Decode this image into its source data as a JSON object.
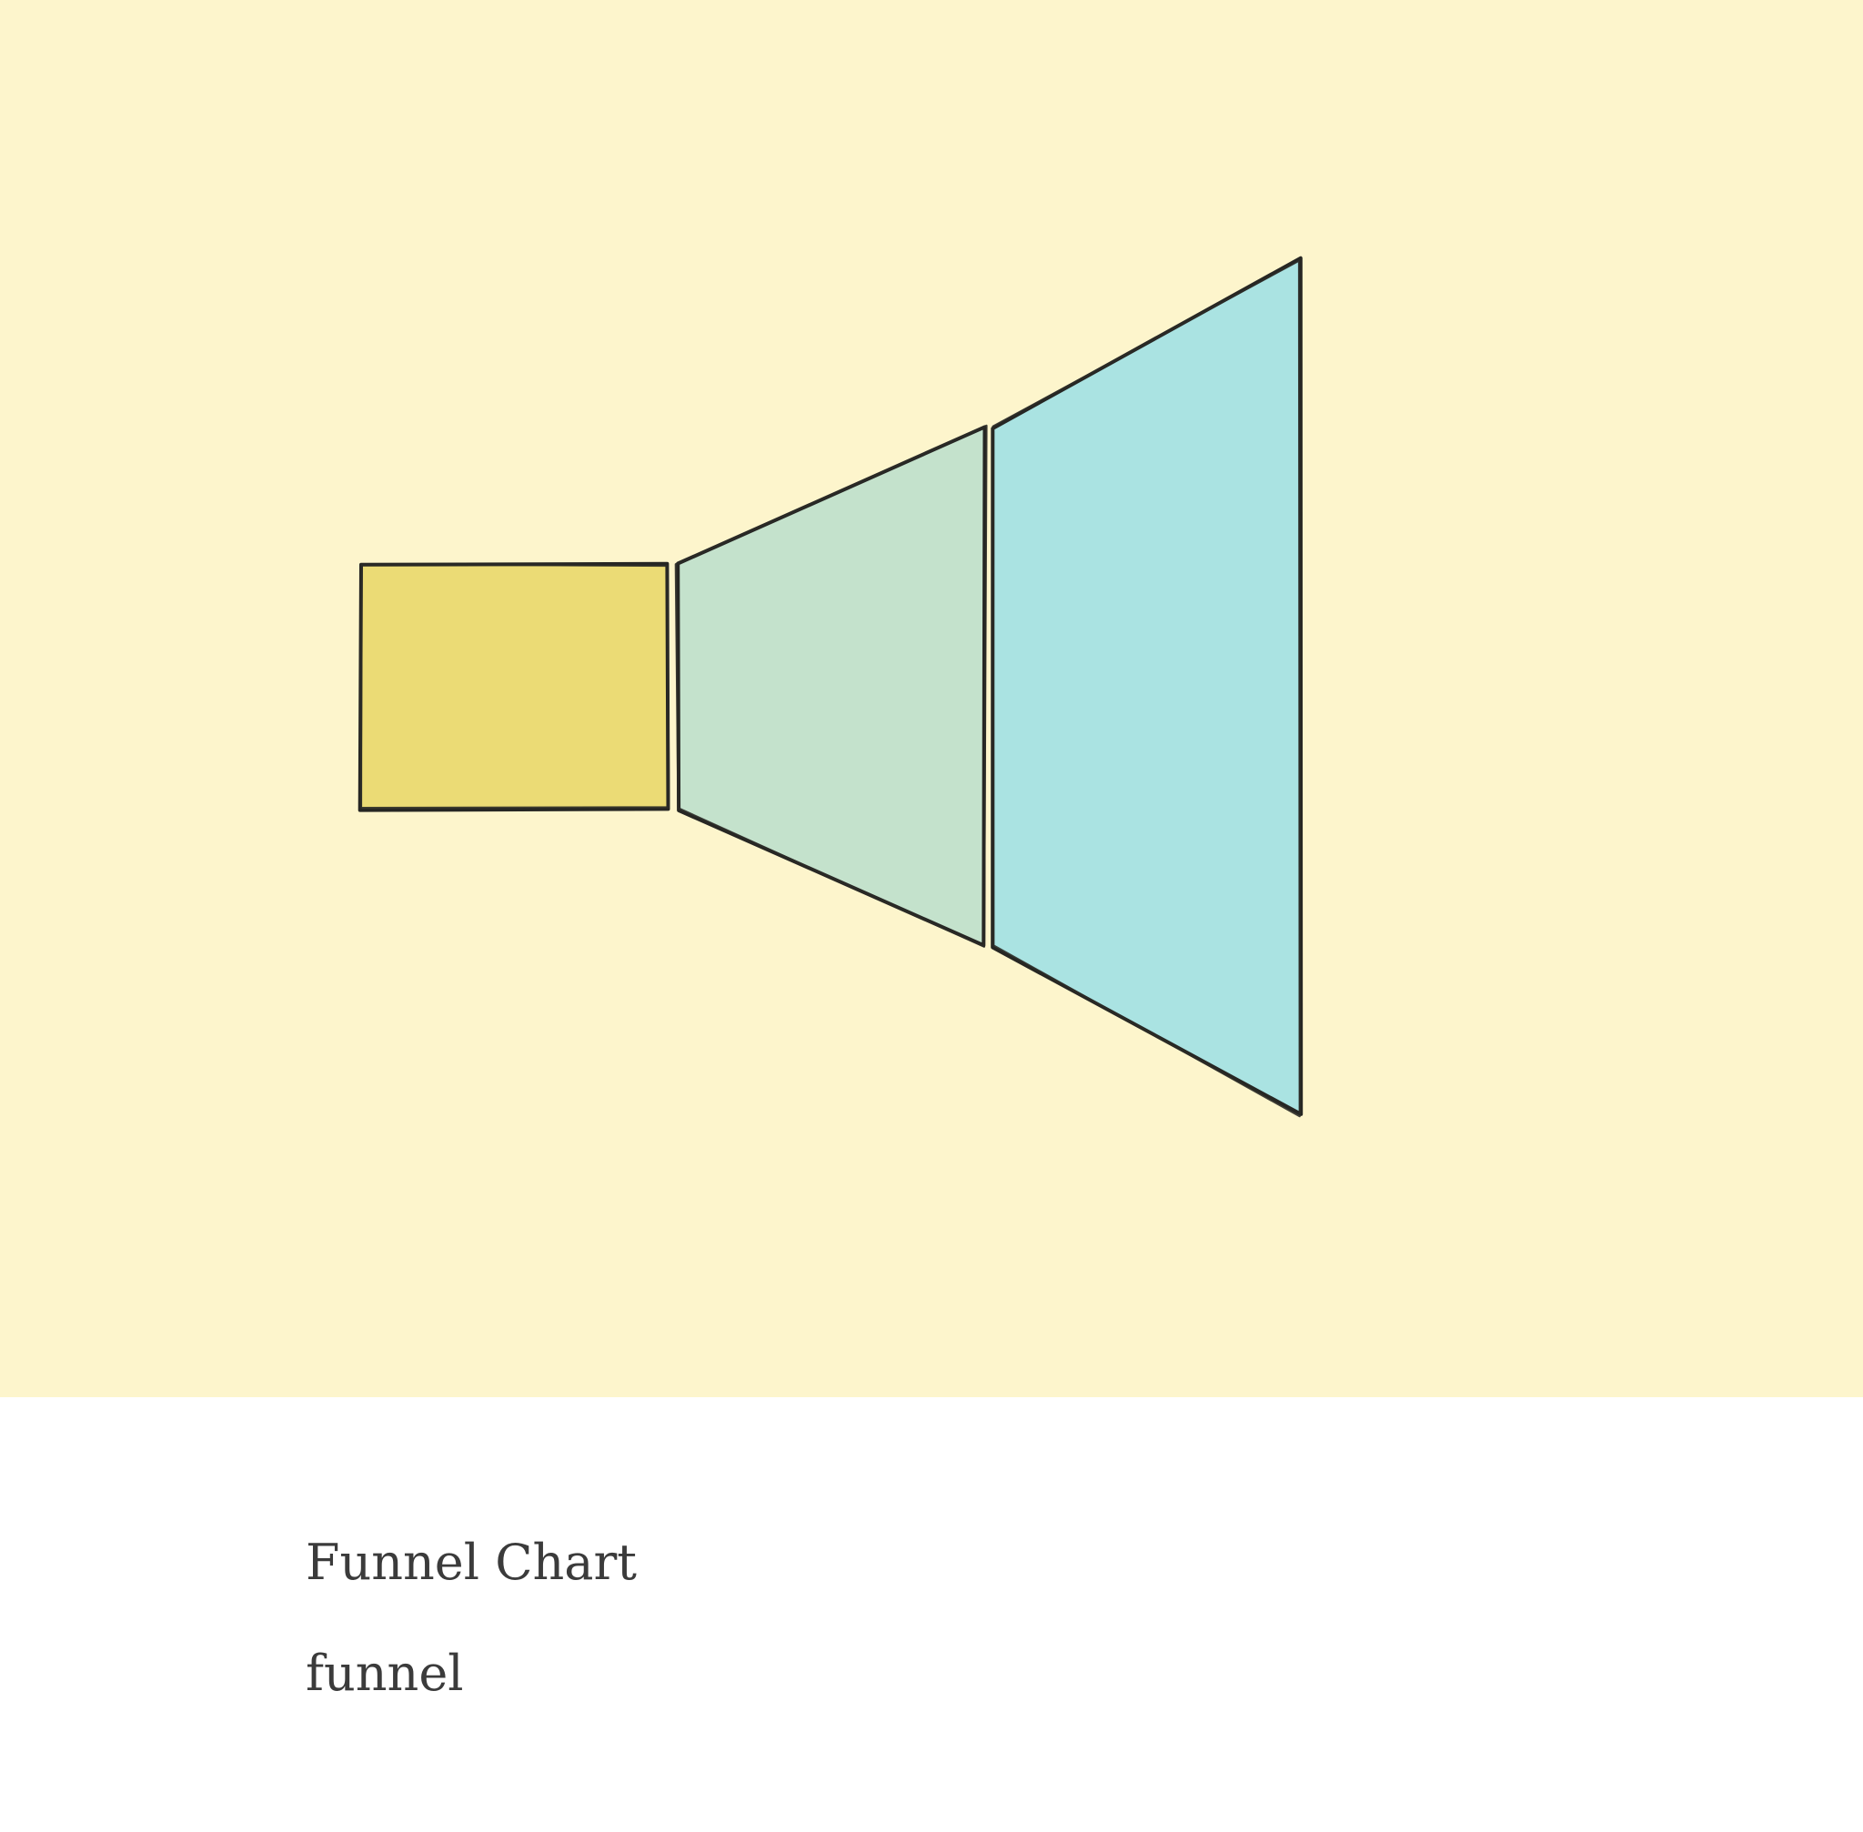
{
  "page": {
    "background": "#fdf5cc",
    "caption_background": "#ffffff",
    "text_color": "#3b3b3b",
    "outline_color": "#262623"
  },
  "caption": {
    "title": "Funnel Chart",
    "subtitle": "funnel"
  },
  "chart_data": {
    "type": "funnel",
    "orientation": "horizontal",
    "style": "hand-drawn",
    "title": "",
    "legend": "none",
    "stages": [
      {
        "value": 8,
        "color": "#ebdb75"
      },
      {
        "value": 17,
        "color": "#c4e2cc"
      },
      {
        "value": 28,
        "color": "#aae3e2"
      }
    ]
  }
}
